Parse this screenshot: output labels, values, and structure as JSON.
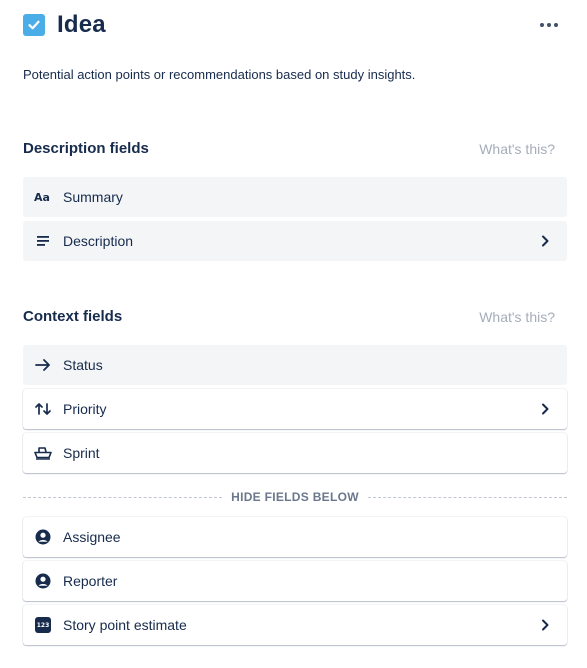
{
  "header": {
    "title": "Idea",
    "issue_type_icon": "checkbox-icon",
    "issue_type_color": "#4bade8",
    "more_icon": "more-horizontal-icon"
  },
  "description": "Potential action points or recommendations based on study insights.",
  "description_section": {
    "title": "Description fields",
    "help_link": "What's this?",
    "fields": [
      {
        "label": "Summary",
        "icon": "text-style-icon",
        "locked": true,
        "has_chevron": false
      },
      {
        "label": "Description",
        "icon": "text-lines-icon",
        "locked": true,
        "has_chevron": true
      }
    ]
  },
  "context_section": {
    "title": "Context fields",
    "help_link": "What's this?",
    "fields": [
      {
        "label": "Status",
        "icon": "arrow-right-icon",
        "locked": true,
        "has_chevron": false
      },
      {
        "label": "Priority",
        "icon": "priority-arrows-icon",
        "locked": false,
        "has_chevron": true
      },
      {
        "label": "Sprint",
        "icon": "sprint-boat-icon",
        "locked": false,
        "has_chevron": false
      }
    ],
    "divider_label": "HIDE FIELDS BELOW",
    "hidden_fields": [
      {
        "label": "Assignee",
        "icon": "user-avatar-icon",
        "has_chevron": false
      },
      {
        "label": "Reporter",
        "icon": "user-avatar-icon",
        "has_chevron": false
      },
      {
        "label": "Story point estimate",
        "icon": "number-icon",
        "icon_text": "123",
        "has_chevron": true
      }
    ]
  }
}
